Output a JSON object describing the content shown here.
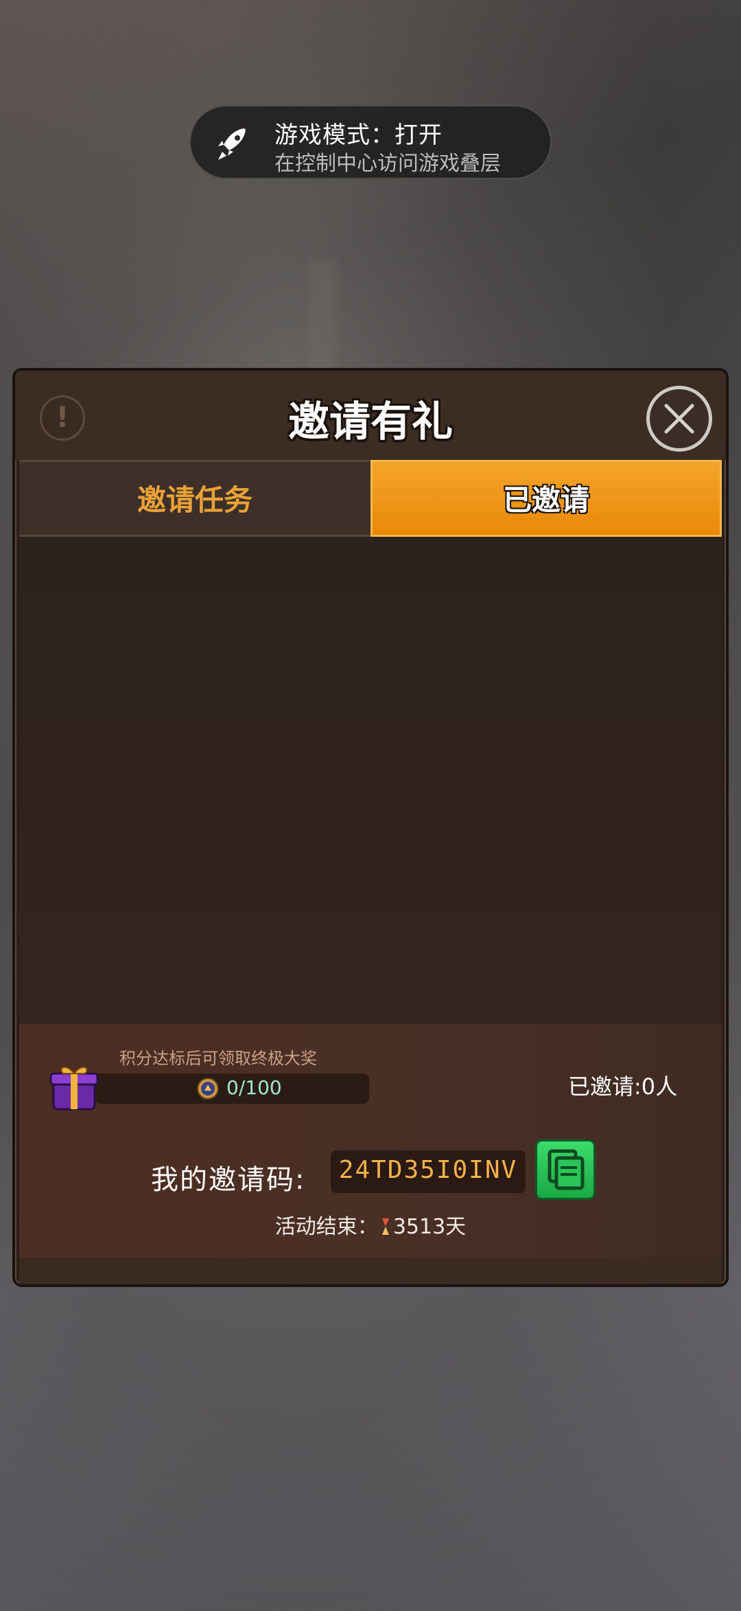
{
  "toast": {
    "title": "游戏模式：打开",
    "subtitle": "在控制中心访问游戏叠层",
    "icon": "rocket-icon"
  },
  "dialog": {
    "title": "邀请有礼",
    "info_icon": "exclamation-icon",
    "close_icon": "close-icon"
  },
  "tabs": [
    {
      "label": "邀请任务",
      "active": false
    },
    {
      "label": "已邀请",
      "active": true
    }
  ],
  "reward": {
    "hint": "积分达标后可领取终极大奖",
    "progress_text": "0/100",
    "progress": 0.0,
    "gift_icon": "gift-icon",
    "coin_icon": "coin-icon"
  },
  "invited": {
    "count_text": "已邀请:0人"
  },
  "invite_code": {
    "label": "我的邀请码:",
    "value": "24TD35I0INV",
    "copy_icon": "copy-icon"
  },
  "event": {
    "prefix": "活动结束：",
    "days": "3513天",
    "icon": "hourglass-icon"
  },
  "colors": {
    "accent_orange": "#e98808",
    "tab_inactive_text": "#e9a237",
    "copy_green": "#2bc458",
    "code_text": "#f3b24a"
  }
}
